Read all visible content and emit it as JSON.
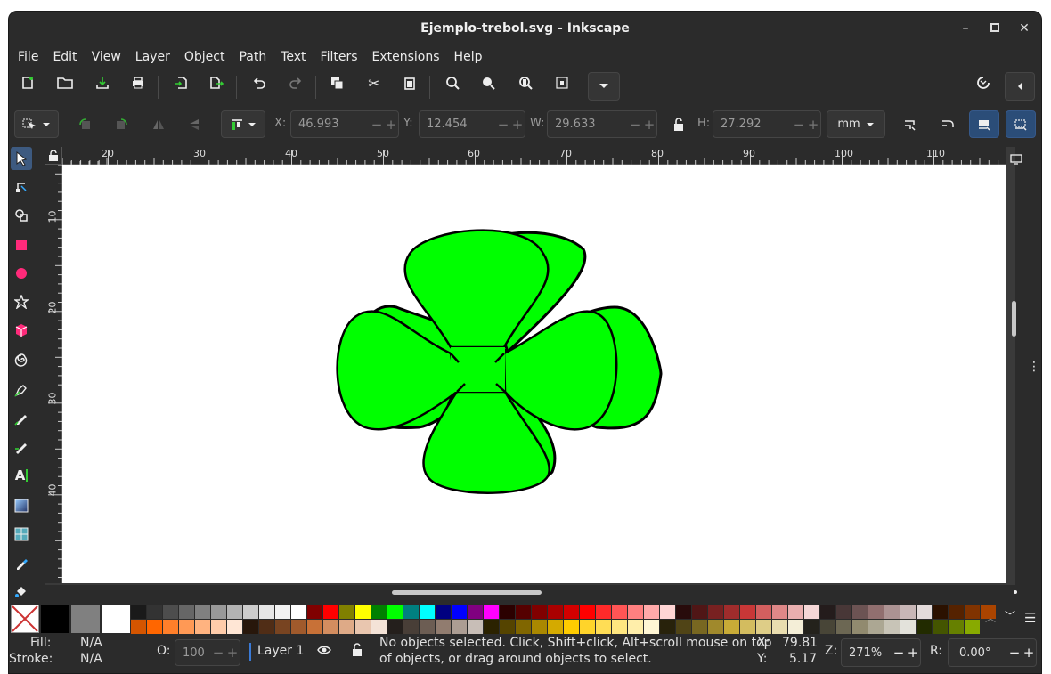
{
  "window": {
    "title": "Ejemplo-trebol.svg - Inkscape"
  },
  "menu": [
    "File",
    "Edit",
    "View",
    "Layer",
    "Object",
    "Path",
    "Text",
    "Filters",
    "Extensions",
    "Help"
  ],
  "selector_toolbar": {
    "x_label": "X:",
    "x_value": "46.993",
    "y_label": "Y:",
    "y_value": "12.454",
    "w_label": "W:",
    "w_value": "29.633",
    "h_label": "H:",
    "h_value": "27.292",
    "unit": "mm"
  },
  "rulers": {
    "h_ticks": [
      "20",
      "30",
      "40",
      "50",
      "60",
      "70",
      "80",
      "90",
      "100",
      "110"
    ],
    "v_ticks": [
      "10",
      "20",
      "30",
      "40"
    ]
  },
  "drawing": {
    "fill": "#00ff00",
    "stroke": "#000000",
    "object": "clover-shape"
  },
  "palette": {
    "row1": [
      "#1a1a1a",
      "#333333",
      "#4d4d4d",
      "#666666",
      "#808080",
      "#999999",
      "#b3b3b3",
      "#cccccc",
      "#e6e6e6",
      "#f2f2f2",
      "#ffffff",
      "#800000",
      "#ff0000",
      "#808000",
      "#ffff00",
      "#008000",
      "#00ff00",
      "#008080",
      "#00ffff",
      "#000080",
      "#0000ff",
      "#800080",
      "#ff00ff",
      "#2b0000",
      "#550000",
      "#800000",
      "#aa0000",
      "#d40000",
      "#ff0000",
      "#ff2a2a",
      "#ff5555",
      "#ff8080",
      "#ffaaaa",
      "#ffd5d5",
      "#280b0b",
      "#501616",
      "#782121",
      "#a02c2c",
      "#c83737",
      "#d35f5f",
      "#de8787",
      "#e9afaf",
      "#f4d7d7",
      "#241c1c",
      "#483737",
      "#6c5353",
      "#916f6f",
      "#ac9393",
      "#c8b7b7",
      "#e3dbdb",
      "#2b1100",
      "#552200",
      "#803300",
      "#aa4400"
    ],
    "row2": [
      "#d45500",
      "#ff6600",
      "#ff7f2a",
      "#ff9955",
      "#ffb380",
      "#ffccaa",
      "#ffe6d5",
      "#28170b",
      "#502d16",
      "#784421",
      "#a05a2c",
      "#c87137",
      "#d38d5f",
      "#deaa87",
      "#e9c6af",
      "#f4e3d7",
      "#241f1c",
      "#483e37",
      "#6c5d53",
      "#917c6f",
      "#ac9d93",
      "#c8beb7",
      "#2b2200",
      "#554400",
      "#806600",
      "#aa8800",
      "#d4aa00",
      "#ffcc00",
      "#ffd42a",
      "#ffdd55",
      "#ffe680",
      "#ffeeaa",
      "#fff6d5",
      "#28220b",
      "#504416",
      "#786721",
      "#a0892c",
      "#c8ab37",
      "#d3bc5f",
      "#decd87",
      "#e9ddaf",
      "#f4eed7",
      "#24221c",
      "#484537",
      "#6c6753",
      "#918a6f",
      "#aca793",
      "#c8c4b7",
      "#e3e2db",
      "#222b00",
      "#445500",
      "#668000",
      "#88aa00"
    ],
    "fixed": [
      "none",
      "#000000",
      "#808080",
      "#ffffff"
    ]
  },
  "status": {
    "fill_label": "Fill:",
    "fill_value": "N/A",
    "stroke_label": "Stroke:",
    "stroke_value": "N/A",
    "opacity_label": "O:",
    "opacity_value": "100",
    "layer": "Layer 1",
    "message_line1": "No objects selected. Click, Shift+click, Alt+scroll mouse on top",
    "message_line2": "of objects, or drag around objects to select.",
    "x_label": "X:",
    "x_value": "79.81",
    "y_label": "Y:",
    "y_value": "5.17",
    "zoom_label": "Z:",
    "zoom_value": "271%",
    "rotation_label": "R:",
    "rotation_value": "0.00°"
  }
}
